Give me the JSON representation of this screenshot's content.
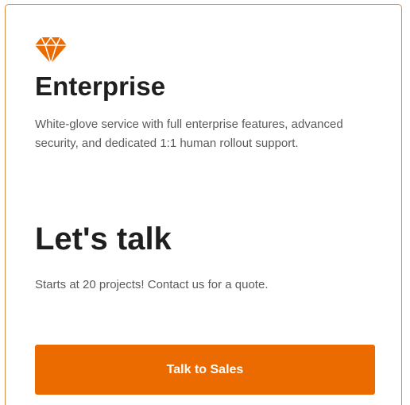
{
  "card": {
    "icon": "gem-icon",
    "accent_color": "#ec6b00",
    "title": "Enterprise",
    "description": "White-glove service with full enterprise features, advanced security, and dedicated 1:1 human rollout support.",
    "price": "Let's talk",
    "price_note": "Starts at 20 projects! Contact us for a quote.",
    "cta_label": "Talk to Sales"
  }
}
